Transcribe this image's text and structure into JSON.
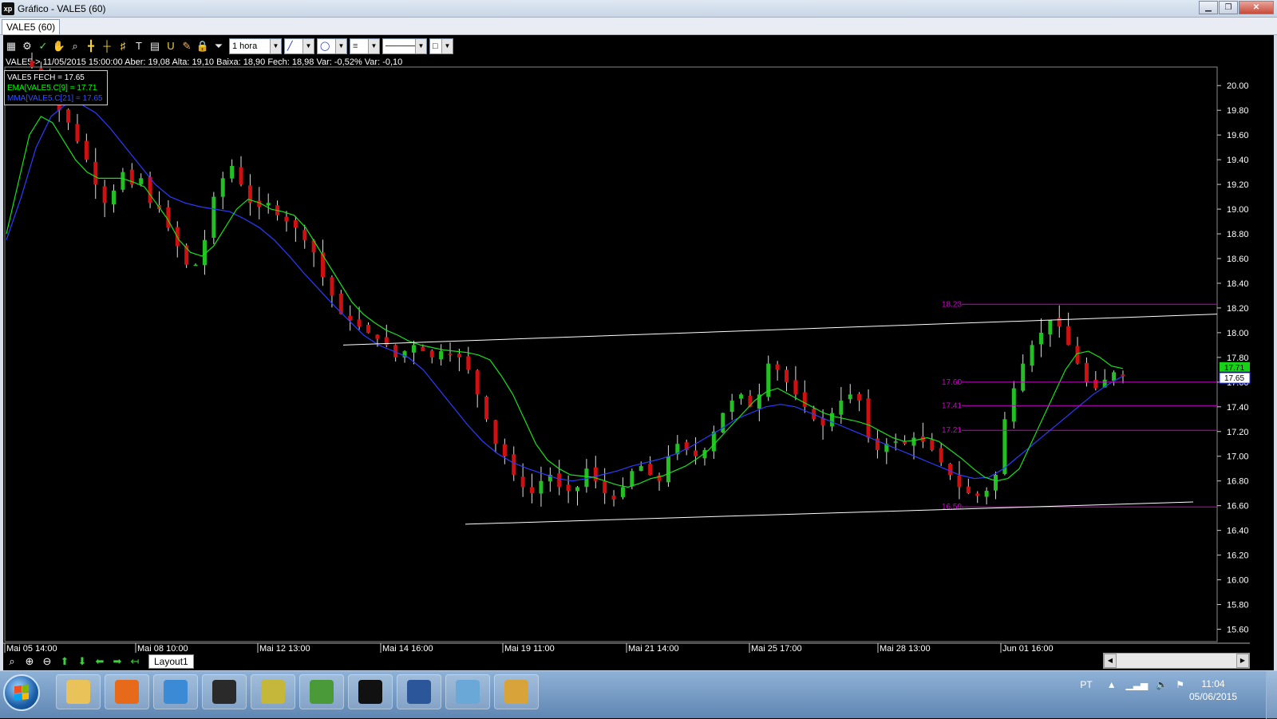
{
  "window": {
    "title": "Gráfico - VALE5 (60)",
    "app_icon": "xp",
    "tab_label": "VALE5 (60)"
  },
  "toolbar": {
    "period": "1 hora",
    "icons": [
      "chart-icon",
      "gear-icon",
      "trend-icon",
      "hand-icon",
      "crosshair-icon",
      "cursor-icon",
      "fibonacci-icon",
      "grid-icon",
      "text-icon",
      "table-icon",
      "magnet-icon",
      "brush-icon",
      "lock-icon",
      "filter-icon"
    ]
  },
  "info": {
    "line": "VALE5-> 11/05/2015 15:00:00 Aber: 19,08 Alta: 19,10 Baixa: 18,90 Fech: 18,98 Var: -0,52% Var: -0,10"
  },
  "legend": {
    "items": [
      {
        "label": "VALE5 FECH = 17.65",
        "color": "#ffffff"
      },
      {
        "label": "EMA[VALE5.C[9] = 17.71",
        "color": "#00ff00"
      },
      {
        "label": "MMA[VALE5.C[21] = 17.65",
        "color": "#3050ff"
      }
    ]
  },
  "chart_data": {
    "type": "candlestick",
    "symbol": "VALE5",
    "interval": "1 hora",
    "ylim": [
      15.5,
      20.15
    ],
    "y_ticks": [
      "20.00",
      "19.80",
      "19.60",
      "19.40",
      "19.20",
      "19.00",
      "18.80",
      "18.60",
      "18.40",
      "18.20",
      "18.00",
      "17.80",
      "17.60",
      "17.40",
      "17.20",
      "17.00",
      "16.80",
      "16.60",
      "16.40",
      "16.20",
      "16.00",
      "15.80",
      "15.60"
    ],
    "x_ticks": [
      "Mai 05 14:00",
      "Mai 08 10:00",
      "Mai 12 13:00",
      "Mai 14 16:00",
      "Mai 19 11:00",
      "Mai 21 14:00",
      "Mai 25 17:00",
      "Mai 28 13:00",
      "Jun 01 16:00"
    ],
    "last_price_labels": {
      "ema": "17.71",
      "last": "17.65"
    },
    "price_levels": [
      {
        "label": "18.23",
        "value": 18.23,
        "color": "#d000d0"
      },
      {
        "label": "17.60",
        "value": 17.6,
        "color": "#d000d0"
      },
      {
        "label": "17.41",
        "value": 17.41,
        "color": "#d000d0"
      },
      {
        "label": "17.21",
        "value": 17.21,
        "color": "#d000d0"
      },
      {
        "label": "16.59",
        "value": 16.59,
        "color": "#d000d0"
      }
    ],
    "trendlines": [
      {
        "name": "upper-channel",
        "from": [
          0.0,
          17.9
        ],
        "to": [
          1.0,
          18.15
        ],
        "color": "#ffffff"
      },
      {
        "name": "lower-channel",
        "from": [
          0.0,
          16.45
        ],
        "to": [
          1.0,
          16.63
        ],
        "color": "#ffffff"
      }
    ],
    "close_path": [
      20.15,
      20.05,
      19.92,
      19.8,
      19.7,
      19.55,
      19.4,
      19.2,
      19.05,
      19.15,
      19.3,
      19.2,
      19.25,
      19.05,
      19.0,
      18.85,
      18.7,
      18.55,
      18.55,
      18.75,
      19.1,
      19.25,
      19.35,
      19.2,
      19.05,
      19.02,
      19.05,
      18.95,
      18.9,
      18.85,
      18.75,
      18.65,
      18.45,
      18.3,
      18.15,
      18.1,
      18.05,
      18.0,
      17.95,
      17.9,
      17.8,
      17.85,
      17.9,
      17.85,
      17.8,
      17.85,
      17.82,
      17.8,
      17.7,
      17.5,
      17.3,
      17.1,
      17.0,
      16.85,
      16.75,
      16.7,
      16.8,
      16.85,
      16.75,
      16.72,
      16.75,
      16.9,
      16.8,
      16.7,
      16.65,
      16.75,
      16.88,
      16.92,
      16.85,
      16.8,
      17.0,
      17.1,
      17.05,
      17.0,
      17.05,
      17.2,
      17.35,
      17.45,
      17.5,
      17.4,
      17.5,
      17.75,
      17.7,
      17.6,
      17.5,
      17.4,
      17.3,
      17.25,
      17.35,
      17.45,
      17.5,
      17.45,
      17.15,
      17.05,
      17.1,
      17.12,
      17.1,
      17.15,
      17.12,
      17.05,
      16.95,
      16.85,
      16.75,
      16.7,
      16.68,
      16.72,
      16.85,
      17.3,
      17.55,
      17.75,
      17.9,
      18.0,
      18.1,
      18.05,
      17.9,
      17.75,
      17.6,
      17.55,
      17.62,
      17.68,
      17.65
    ],
    "ema9": [
      18.8,
      19.2,
      19.6,
      19.75,
      19.7,
      19.55,
      19.4,
      19.3,
      19.25,
      19.25,
      19.25,
      19.22,
      19.18,
      19.05,
      18.92,
      18.75,
      18.65,
      18.62,
      18.7,
      18.85,
      19.0,
      19.08,
      19.05,
      19.0,
      18.98,
      18.95,
      18.85,
      18.7,
      18.55,
      18.4,
      18.25,
      18.15,
      18.08,
      18.02,
      17.98,
      17.93,
      17.9,
      17.88,
      17.86,
      17.85,
      17.84,
      17.82,
      17.78,
      17.65,
      17.5,
      17.3,
      17.1,
      16.97,
      16.9,
      16.85,
      16.84,
      16.83,
      16.8,
      16.77,
      16.75,
      16.78,
      16.82,
      16.84,
      16.88,
      16.92,
      16.98,
      17.05,
      17.15,
      17.25,
      17.35,
      17.45,
      17.52,
      17.55,
      17.5,
      17.45,
      17.4,
      17.35,
      17.32,
      17.3,
      17.28,
      17.25,
      17.2,
      17.15,
      17.12,
      17.13,
      17.15,
      17.12,
      17.05,
      16.98,
      16.9,
      16.83,
      16.8,
      16.82,
      16.9,
      17.1,
      17.3,
      17.5,
      17.7,
      17.83,
      17.85,
      17.8,
      17.73,
      17.71
    ],
    "sma21": [
      18.75,
      19.1,
      19.5,
      19.75,
      19.85,
      19.85,
      19.78,
      19.65,
      19.5,
      19.35,
      19.2,
      19.1,
      19.05,
      19.02,
      19.0,
      18.98,
      18.92,
      18.85,
      18.75,
      18.62,
      18.48,
      18.35,
      18.22,
      18.1,
      17.98,
      17.9,
      17.85,
      17.8,
      17.7,
      17.55,
      17.4,
      17.25,
      17.12,
      17.02,
      16.95,
      16.9,
      16.86,
      16.82,
      16.8,
      16.82,
      16.85,
      16.88,
      16.92,
      16.95,
      16.98,
      17.02,
      17.08,
      17.15,
      17.22,
      17.3,
      17.35,
      17.4,
      17.42,
      17.4,
      17.35,
      17.3,
      17.25,
      17.2,
      17.15,
      17.1,
      17.05,
      17.0,
      16.95,
      16.9,
      16.85,
      16.82,
      16.83,
      16.9,
      17.0,
      17.1,
      17.2,
      17.3,
      17.4,
      17.5,
      17.58,
      17.65
    ]
  },
  "navigation": {
    "layout_tab": "Layout1"
  },
  "taskbar": {
    "apps": [
      {
        "name": "folder",
        "color": "#e9c35a"
      },
      {
        "name": "media-player",
        "color": "#e76a1a"
      },
      {
        "name": "bird",
        "color": "#3a8ad6"
      },
      {
        "name": "hp",
        "color": "#2a2a2a"
      },
      {
        "name": "dollar",
        "color": "#c5b73a"
      },
      {
        "name": "chrome",
        "color": "#4a9a3a"
      },
      {
        "name": "xp",
        "color": "#111111"
      },
      {
        "name": "word",
        "color": "#2b579a"
      },
      {
        "name": "photos",
        "color": "#6aa8d8"
      },
      {
        "name": "paint",
        "color": "#d8a43a"
      }
    ],
    "tray_lang": "PT",
    "time": "11:04",
    "date": "05/06/2015"
  }
}
